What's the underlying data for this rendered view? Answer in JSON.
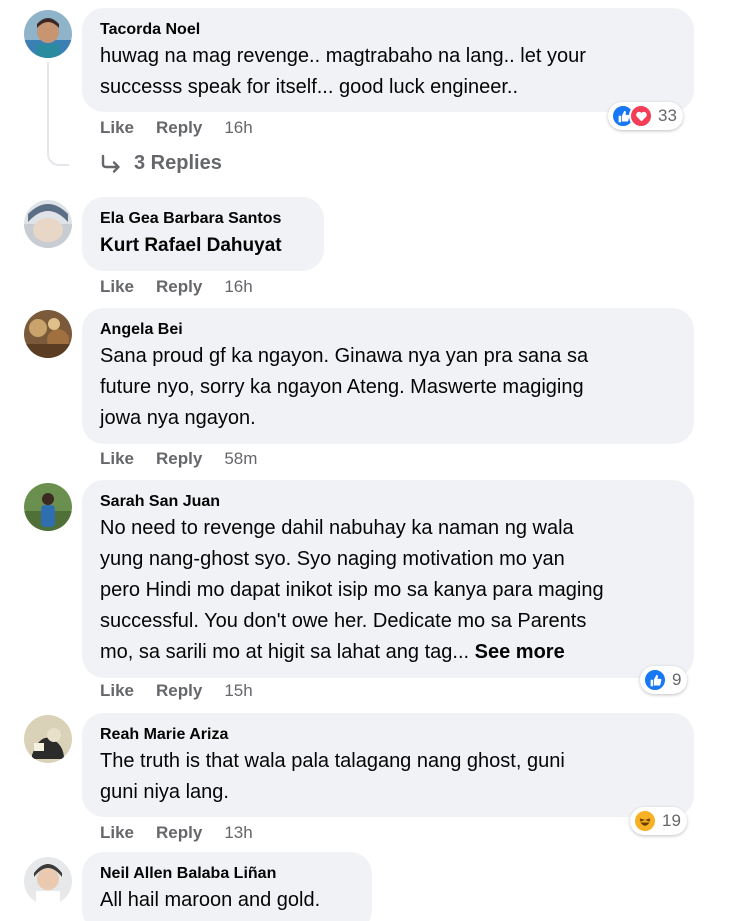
{
  "comments": [
    {
      "author": "Tacorda Noel",
      "lines": [
        "huwag na mag revenge.. magtrabaho na lang.. let your",
        "successs speak for itself... good luck engineer.."
      ],
      "time": "16h",
      "reactions": {
        "icons": [
          "like-icon",
          "love-icon"
        ],
        "count": "33"
      }
    },
    {
      "author": "Ela Gea Barbara Santos",
      "tagged": "Kurt Rafael Dahuyat",
      "time": "16h"
    },
    {
      "author": "Angela Bei",
      "lines": [
        "Sana proud gf ka ngayon. Ginawa nya yan pra sana sa",
        "future nyo, sorry ka ngayon Ateng. Maswerte magiging",
        "jowa nya ngayon."
      ],
      "time": "58m"
    },
    {
      "author": "Sarah San Juan",
      "lines": [
        "No need to revenge dahil nabuhay ka naman ng wala",
        "yung nang-ghost syo. Syo naging motivation mo yan",
        "pero Hindi mo dapat inikot isip mo sa kanya para maging",
        "successful. You don't owe her. Dedicate mo sa Parents",
        "mo, sa sarili mo at higit sa lahat ang tag..."
      ],
      "see_more": "See more",
      "time": "15h",
      "reactions": {
        "icons": [
          "like-icon"
        ],
        "count": "9"
      }
    },
    {
      "author": "Reah Marie Ariza",
      "lines": [
        "The truth is that wala pala talagang nang ghost, guni",
        "guni niya lang."
      ],
      "time": "13h",
      "reactions": {
        "icons": [
          "haha-icon"
        ],
        "count": "19"
      }
    },
    {
      "author": "Neil Allen Balaba Liñan",
      "lines": [
        "All hail maroon and gold."
      ]
    }
  ],
  "actions": {
    "like": "Like",
    "reply": "Reply"
  },
  "replies_label": "3 Replies",
  "colors": {
    "bubble": "#f0f2f5",
    "meta": "#65676b",
    "like": "#1877f2",
    "love": "#f33e58",
    "haha": "#f7b125"
  }
}
